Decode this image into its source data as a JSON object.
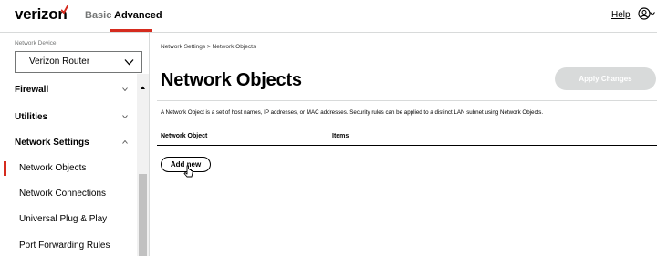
{
  "header": {
    "logo": "verizon",
    "tabs": [
      {
        "label": "Basic",
        "active": false
      },
      {
        "label": "Advanced",
        "active": true
      }
    ],
    "help_label": "Help",
    "user_icon": "user-circle-icon",
    "brand_color": "#d52b1e"
  },
  "sidebar": {
    "device_label": "Network Device",
    "device_value": "Verizon Router",
    "items": [
      {
        "label": "Firewall",
        "bold": true,
        "chevron": "down"
      },
      {
        "label": "Utilities",
        "bold": true,
        "chevron": "down"
      },
      {
        "label": "Network Settings",
        "bold": true,
        "chevron": "up"
      },
      {
        "label": "Network Objects",
        "bold": false,
        "active": true
      },
      {
        "label": "Network Connections",
        "bold": false
      },
      {
        "label": "Universal Plug & Play",
        "bold": false
      },
      {
        "label": "Port Forwarding Rules",
        "bold": false
      }
    ]
  },
  "main": {
    "breadcrumb": "Network Settings  >  Network Objects",
    "title": "Network Objects",
    "apply_label": "Apply Changes",
    "description": "A Network Object is a set of host names, IP addresses, or MAC addresses. Security rules can be applied to a distinct LAN subnet using Network Objects.",
    "table": {
      "columns": [
        "Network Object",
        "Items"
      ],
      "rows": []
    },
    "add_label": "Add new"
  }
}
